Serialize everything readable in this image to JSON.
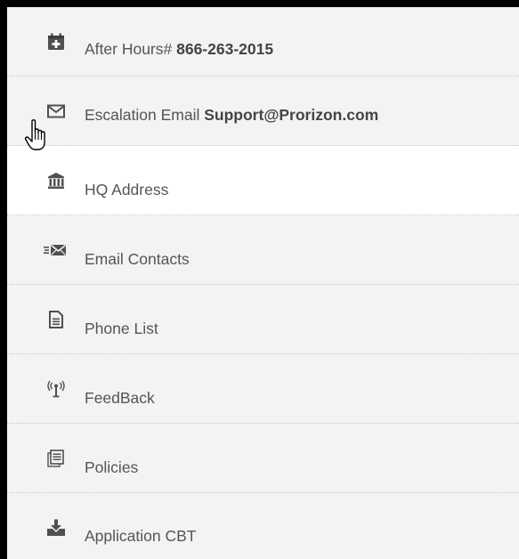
{
  "menu": {
    "items": [
      {
        "label": "After Hours#",
        "value": "866-263-2015",
        "icon": "calendar-plus-icon"
      },
      {
        "label": "Escalation Email",
        "value": "Support@Prorizon.com",
        "icon": "envelope-icon"
      },
      {
        "label": "HQ Address",
        "value": "",
        "icon": "bank-icon"
      },
      {
        "label": "Email Contacts",
        "value": "",
        "icon": "fast-envelope-icon"
      },
      {
        "label": "Phone List",
        "value": "",
        "icon": "document-icon"
      },
      {
        "label": "FeedBack",
        "value": "",
        "icon": "antenna-icon"
      },
      {
        "label": "Policies",
        "value": "",
        "icon": "documents-icon"
      },
      {
        "label": "Application CBT",
        "value": "",
        "icon": "download-tray-icon"
      }
    ]
  },
  "colors": {
    "panel_background": "#f3f3f3",
    "hover_background": "#ffffff",
    "icon_color": "#505050",
    "text_color": "#555555"
  },
  "cursor": {
    "icon": "hand-pointer-icon"
  }
}
